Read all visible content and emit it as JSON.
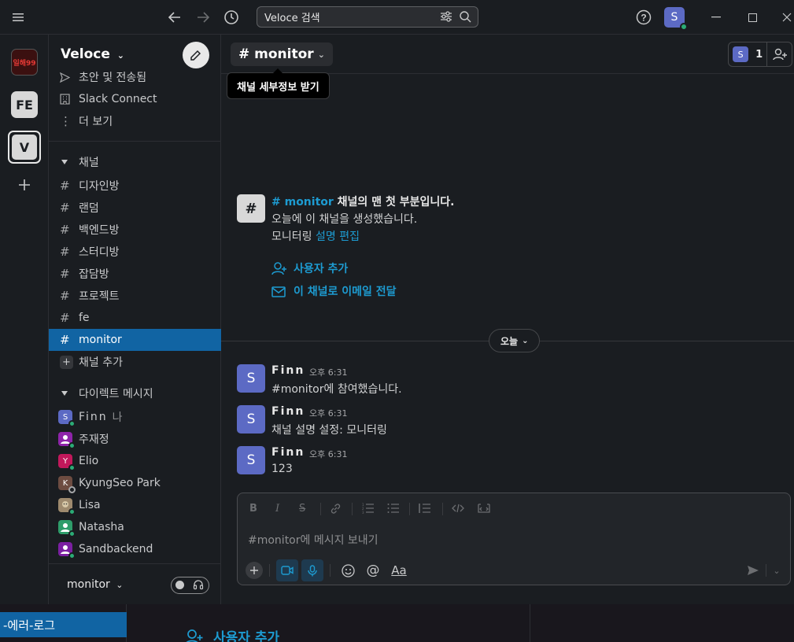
{
  "titlebar": {
    "search_text": "Veloce 검색",
    "user_initial": "S"
  },
  "rail": {
    "workspaces": [
      {
        "label": "일해99",
        "color": "#7b1c1c"
      },
      {
        "label": "FE",
        "color": "#d8d8d8"
      },
      {
        "label": "V",
        "color": "#d8d8d8"
      }
    ]
  },
  "sidebar": {
    "workspace_name": "Veloce",
    "nav": [
      {
        "label": "초안 및 전송됨",
        "icon": "send-icon"
      },
      {
        "label": "Slack Connect",
        "icon": "building-icon"
      },
      {
        "label": "더 보기",
        "icon": "more-vertical-icon"
      }
    ],
    "channels_header": "채널",
    "channels": [
      "디자인방",
      "랜덤",
      "백엔드방",
      "스터디방",
      "잡담방",
      "프로젝트",
      "fe",
      "monitor"
    ],
    "active_channel": "monitor",
    "add_channel": "채널 추가",
    "dm_header": "다이렉트 메시지",
    "dms": [
      {
        "name": "Finn",
        "suffix": "나",
        "initial": "S",
        "color": "#5c6ac4",
        "status": "#2bac76"
      },
      {
        "name": "주재정",
        "suffix": "",
        "initial": "",
        "color": "#8e24aa",
        "status": "#2bac76"
      },
      {
        "name": "Elio",
        "suffix": "",
        "initial": "Y",
        "color": "#c2185b",
        "status": "#2bac76"
      },
      {
        "name": "KyungSeo Park",
        "suffix": "",
        "initial": "K",
        "color": "#6d4c41",
        "status": "#8e8f91"
      },
      {
        "name": "Lisa",
        "suffix": "",
        "initial": "",
        "color": "#9e8a6e",
        "status": "#2bac76"
      },
      {
        "name": "Natasha",
        "suffix": "",
        "initial": "",
        "color": "#2e9d6a",
        "status": "#2bac76"
      },
      {
        "name": "Sandbackend",
        "suffix": "",
        "initial": "",
        "color": "#7b1fa2",
        "status": "#2bac76"
      }
    ],
    "footer_label": "monitor"
  },
  "channel": {
    "title": "# monitor",
    "tooltip": "채널 세부정보 받기",
    "member_initial": "S",
    "member_count": "1",
    "intro_channel": "# monitor",
    "intro_title_rest": " 채널의 맨 첫 부분입니다.",
    "intro_created": "오늘에 이 채널을 생성했습니다.",
    "intro_desc": "모니터링",
    "intro_edit": "설명 편집",
    "action_add_user": "사용자 추가",
    "action_email": "이 채널로 이메일 전달",
    "day_label": "오늘"
  },
  "messages": [
    {
      "initial": "S",
      "name": "Finn",
      "time": "오후 6:31",
      "text": "#monitor에 참여했습니다."
    },
    {
      "initial": "S",
      "name": "Finn",
      "time": "오후 6:31",
      "text": "채널 설명 설정: 모니터링"
    },
    {
      "initial": "S",
      "name": "Finn",
      "time": "오후 6:31",
      "text": "123"
    }
  ],
  "composer": {
    "placeholder": "#monitor에 메시지 보내기",
    "text_format_label": "Aa"
  },
  "behind_window": {
    "selected_item": "-에러-로그",
    "add_user": "사용자 추가"
  }
}
